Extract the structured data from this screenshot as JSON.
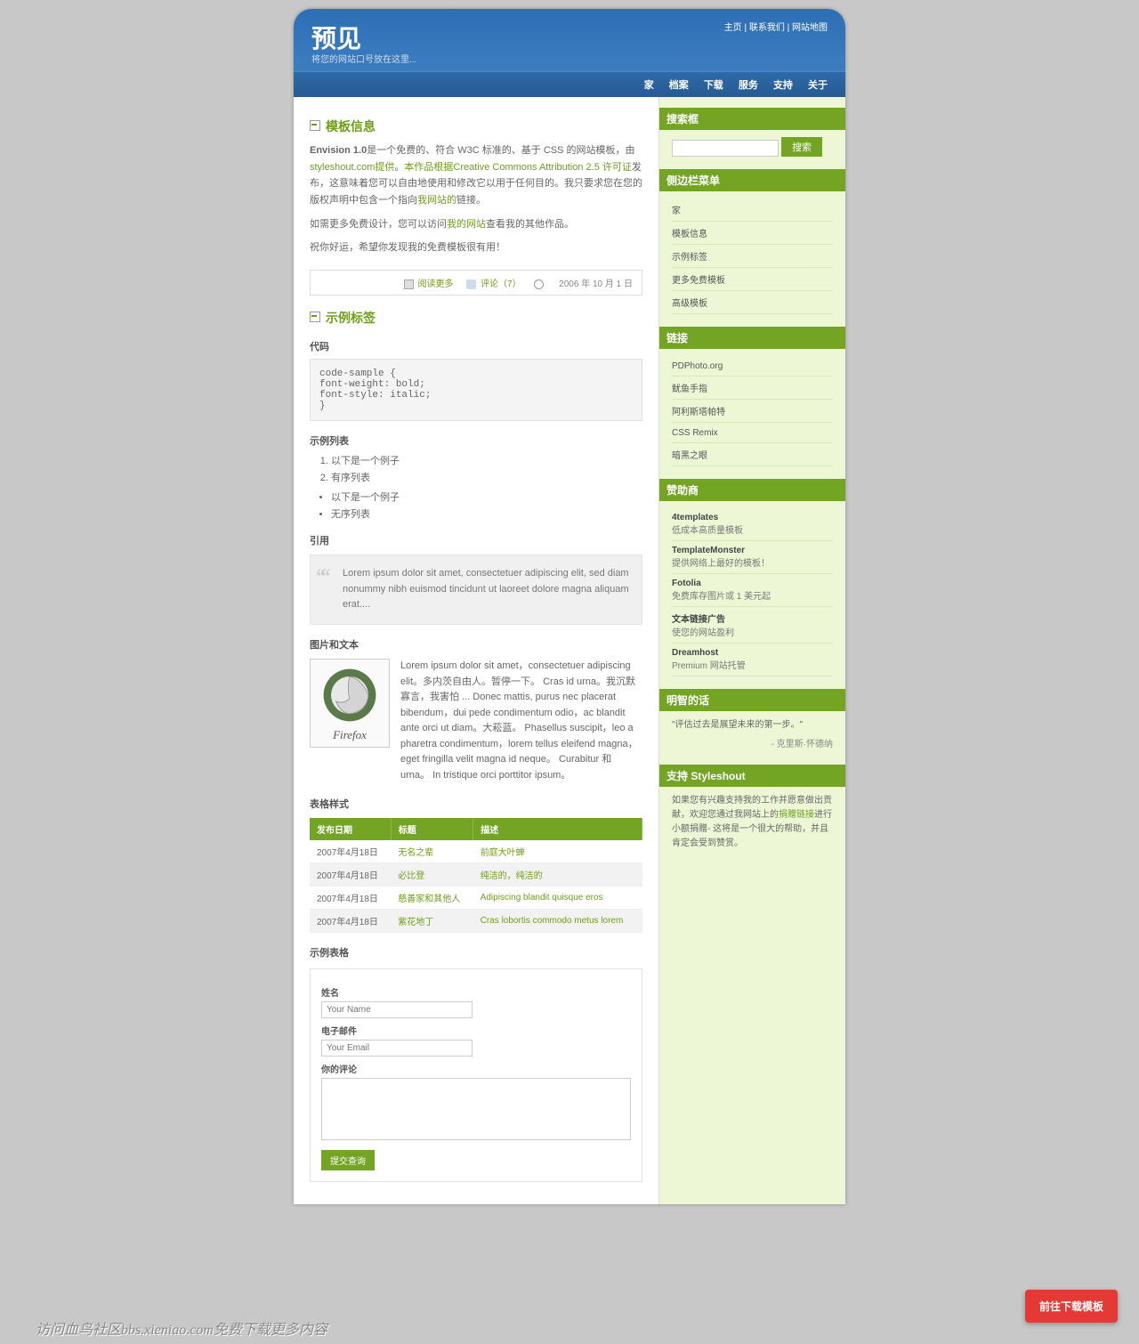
{
  "header": {
    "title": "预见",
    "slogan": "将您的网站口号放在这里...",
    "toplinks": [
      {
        "label": "主页"
      },
      {
        "label": "联系我们"
      },
      {
        "label": "网站地图"
      }
    ]
  },
  "nav": [
    {
      "label": "家"
    },
    {
      "label": "档案"
    },
    {
      "label": "下载"
    },
    {
      "label": "服务"
    },
    {
      "label": "支持"
    },
    {
      "label": "关于"
    }
  ],
  "post1": {
    "heading": "模板信息",
    "intro_prefix": "Envision 1.0",
    "intro_1": "是一个免费的、符合 W3C 标准的、基于 CSS 的网站模板，由",
    "link1": "styleshout.com提供",
    "intro_2": "。",
    "link2": "本作品根据Creative Commons Attribution 2.5 许可证",
    "intro_3": "发布，这意味着您可以自由地使用和修改它以用于任何目的。我只要求您在您的版权声明中包含一个指向",
    "link3": "我网站的",
    "intro_4": "链接。",
    "p2_a": "如需更多免费设计，您可以访问",
    "p2_link": "我的网站",
    "p2_b": "查看我的其他作品。",
    "p3": "祝你好运，希望你发现我的免费模板很有用！",
    "meta": {
      "readmore": "阅读更多",
      "comments": "评论（7）",
      "date": "2006 年 10 月 1 日"
    }
  },
  "post2": {
    "heading": "示例标签",
    "code_h": "代码",
    "code": "code-sample {\nfont-weight: bold;\nfont-style: italic;\n}",
    "list_h": "示例列表",
    "ol": [
      "以下是一个例子",
      "有序列表"
    ],
    "ul": [
      "以下是一个例子",
      "无序列表"
    ],
    "quote_h": "引用",
    "quote": "Lorem ipsum dolor sit amet, consectetuer adipiscing elit, sed diam nonummy nibh euismod tincidunt ut laoreet dolore magna aliquam erat....",
    "img_h": "图片和文本",
    "img_caption": "Firefox",
    "img_text": "Lorem ipsum dolor sit amet，consectetuer adipiscing elit。多内茨自由人。暂停一下。 Cras id urna。我沉默寡言，我害怕 ... Donec mattis, purus nec placerat bibendum，dui pede condimentum odio，ac blandit ante orci ut diam。大菘蓝。 Phasellus suscipit，leo a pharetra condimentum，lorem tellus eleifend magna，eget fringilla velit magna id neque。 Curabitur 和 urna。 In tristique orci porttitor ipsum。",
    "table_h": "表格样式",
    "table": {
      "headers": [
        "发布日期",
        "标题",
        "描述"
      ],
      "rows": [
        {
          "date": "2007年4月18日",
          "title": "无名之辈",
          "desc": "前庭大叶蝉"
        },
        {
          "date": "2007年4月18日",
          "title": "必比登",
          "desc": "纯洁的，纯洁的"
        },
        {
          "date": "2007年4月18日",
          "title": "慈善家和其他人",
          "desc": "Adipiscing blandit quisque eros"
        },
        {
          "date": "2007年4月18日",
          "title": "紫花地丁",
          "desc": "Cras lobortis commodo metus lorem"
        }
      ]
    },
    "form_h": "示例表格",
    "form": {
      "name_label": "姓名",
      "name_ph": "Your Name",
      "email_label": "电子邮件",
      "email_ph": "Your Email",
      "comment_label": "你的评论",
      "submit": "提交查询"
    }
  },
  "sidebar": {
    "search_h": "搜索框",
    "search_btn": "搜索",
    "menu_h": "侧边栏菜单",
    "menu": [
      {
        "label": "家"
      },
      {
        "label": "模板信息"
      },
      {
        "label": "示例标签"
      },
      {
        "label": "更多免费模板"
      },
      {
        "label": "高级模板"
      }
    ],
    "links_h": "链接",
    "links": [
      {
        "label": "PDPhoto.org"
      },
      {
        "label": "鱿鱼手指"
      },
      {
        "label": "阿利斯塔帕特"
      },
      {
        "label": "CSS Remix"
      },
      {
        "label": "暗黑之眼"
      }
    ],
    "sponsors_h": "赞助商",
    "sponsors": [
      {
        "name": "4templates",
        "desc": "低成本高质量模板"
      },
      {
        "name": "TemplateMonster",
        "desc": "提供网络上最好的模板！"
      },
      {
        "name": "Fotolia",
        "desc": "免费库存图片或 1 美元起"
      },
      {
        "name": "文本链接广告",
        "desc": "使您的网站盈利"
      },
      {
        "name": "Dreamhost",
        "desc": "Premium 网站托管"
      }
    ],
    "wise_h": "明智的话",
    "wise_quote": "\"评估过去是展望未来的第一步。\"",
    "wise_attr": "- 克里斯·怀德纳",
    "support_h": "支持 Styleshout",
    "support_1": "如果您有兴趣支持我的工作并愿意做出贡献，欢迎您通过我网站上的",
    "support_link": "捐赠链接",
    "support_2": "进行小额捐赠- 这将是一个很大的帮助，并且肯定会受到赞赏。"
  },
  "promo": "前往下载模板",
  "watermark": "访问血鸟社区bbs.xieniao.com免费下载更多内容"
}
